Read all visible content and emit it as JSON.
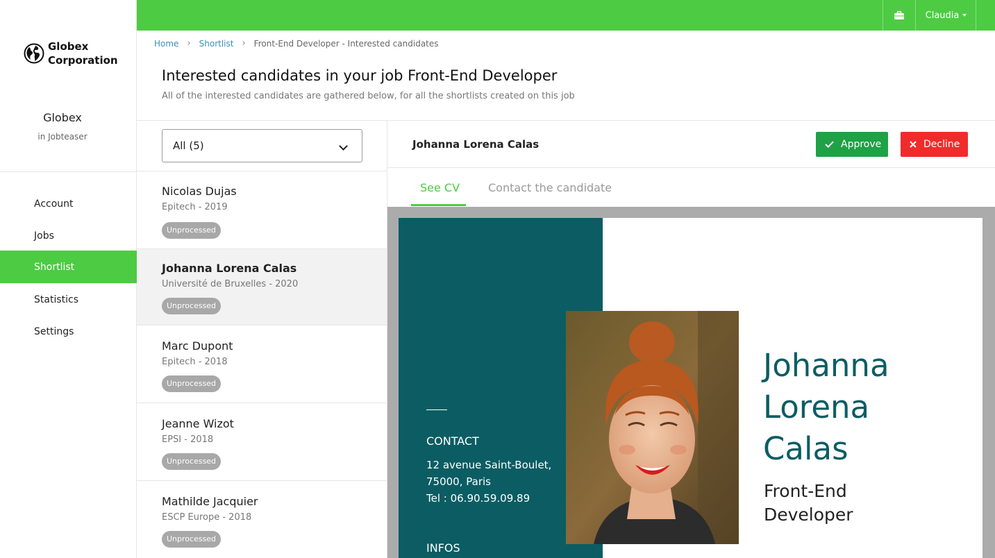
{
  "app": {
    "logo_line1": "Globex",
    "logo_line2": "Corporation",
    "company": "Globex",
    "company_sub": "in Jobteaser",
    "accent_color": "#4dcb43"
  },
  "topbar": {
    "briefcase_icon": "briefcase-icon",
    "user_name": "Claudia"
  },
  "nav": {
    "items": [
      {
        "label": "Account"
      },
      {
        "label": "Jobs"
      },
      {
        "label": "Shortlist",
        "active": true
      },
      {
        "label": "Statistics"
      },
      {
        "label": "Settings"
      }
    ]
  },
  "breadcrumb": {
    "home": "Home",
    "shortlist": "Shortlist",
    "current": "Front-End Developer - Interested candidates"
  },
  "header": {
    "title": "Interested candidates in your job Front-End Developer",
    "subtitle": "All of the interested candidates are gathered below, for all the shortlists created on this job"
  },
  "filter": {
    "selected": "All (5)"
  },
  "candidates": [
    {
      "name": "Nicolas Dujas",
      "school": "Epitech - 2019",
      "status": "Unprocessed"
    },
    {
      "name": "Johanna Lorena Calas",
      "school": "Université de Bruxelles - 2020",
      "status": "Unprocessed",
      "selected": true
    },
    {
      "name": "Marc Dupont",
      "school": "Epitech - 2018",
      "status": "Unprocessed"
    },
    {
      "name": "Jeanne Wizot",
      "school": "EPSI - 2018",
      "status": "Unprocessed"
    },
    {
      "name": "Mathilde Jacquier",
      "school": "ESCP Europe - 2018",
      "status": "Unprocessed"
    }
  ],
  "detail": {
    "name": "Johanna Lorena Calas",
    "approve_label": "Approve",
    "decline_label": "Decline",
    "approve_color": "#1fa146",
    "decline_color": "#f02b2b",
    "tabs": [
      {
        "label": "See CV",
        "active": true
      },
      {
        "label": "Contact the candidate"
      }
    ]
  },
  "cv": {
    "contact_heading": "CONTACT",
    "address_line1": "12 avenue Saint-Boulet,",
    "address_line2": "75000, Paris",
    "phone": "Tel : 06.90.59.09.89",
    "infos_heading": "INFOS",
    "name_line1": "Johanna",
    "name_line2": "Lorena",
    "name_line3": "Calas",
    "role_line1": "Front-End",
    "role_line2": "Developer",
    "panel_color": "#0b5d63"
  }
}
